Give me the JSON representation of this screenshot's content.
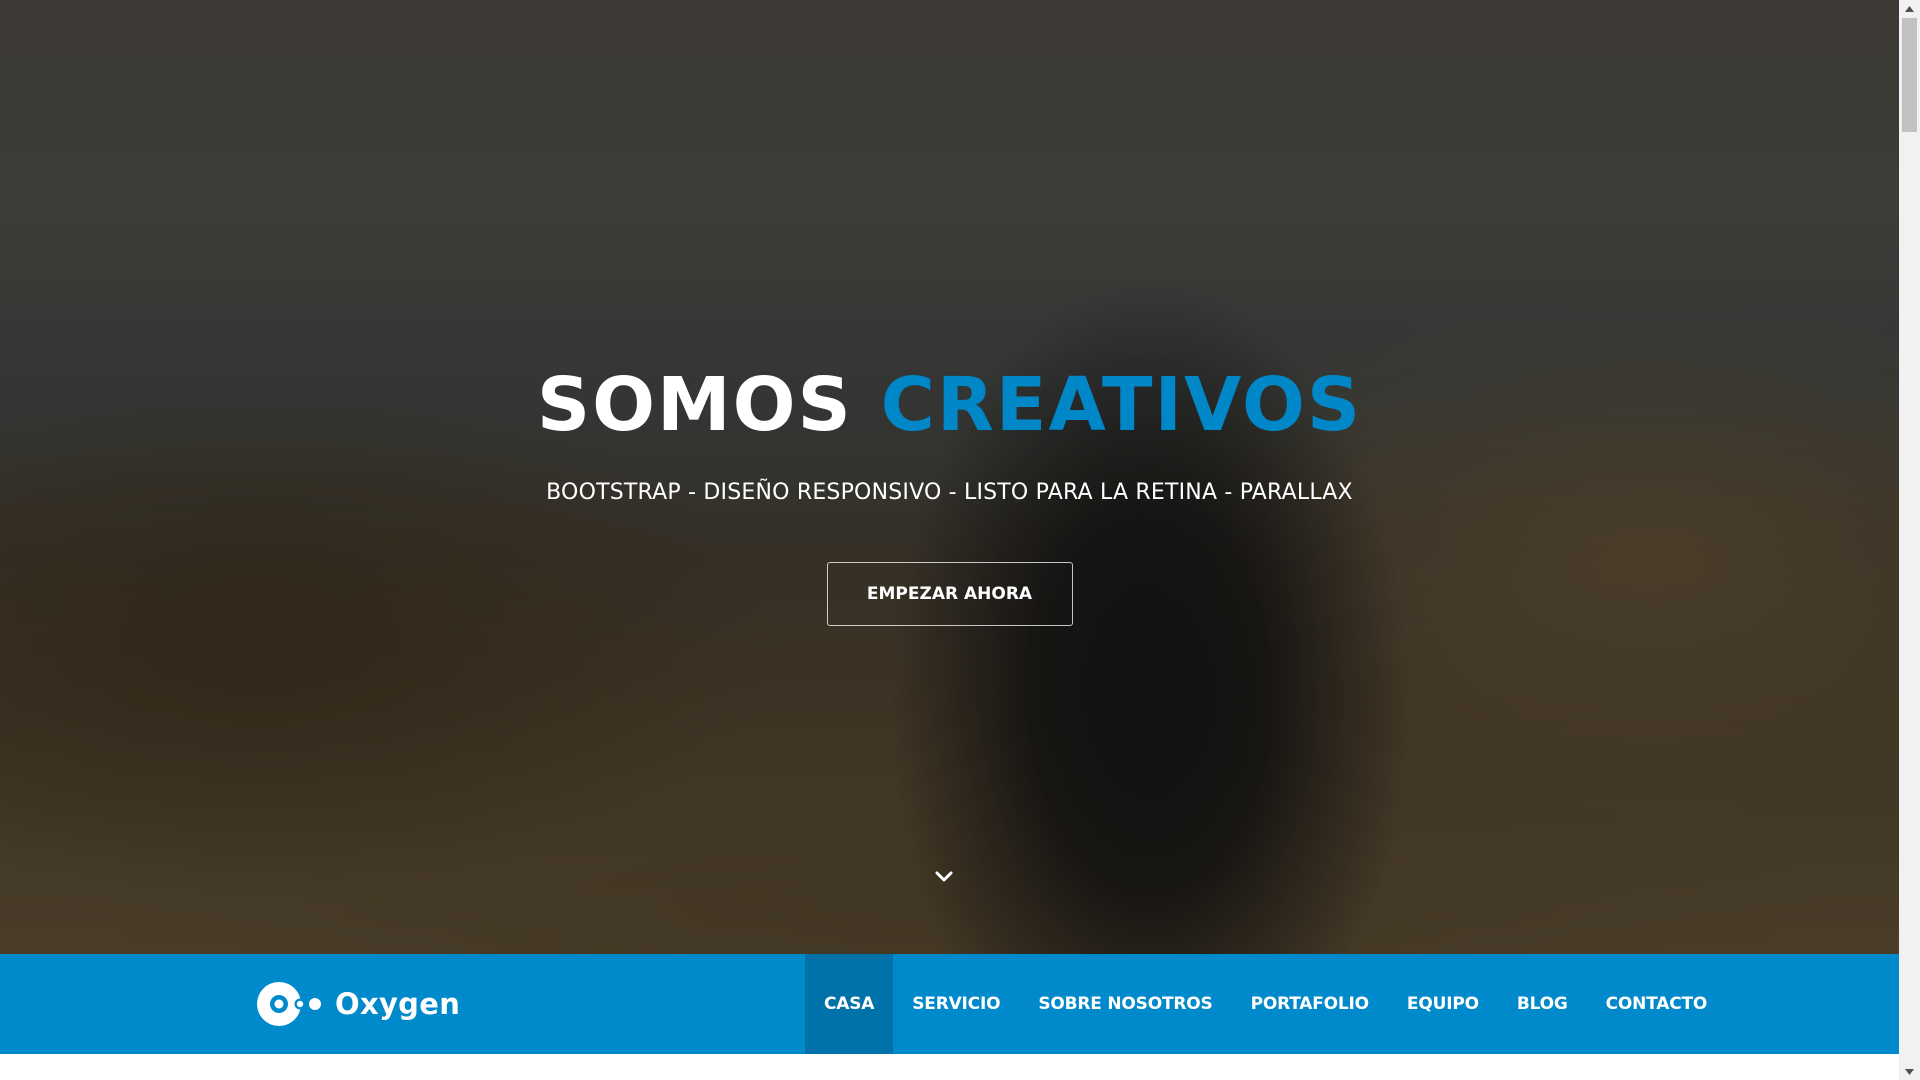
{
  "hero": {
    "title_main": "SOMOS",
    "title_accent": "CREATIVOS",
    "subtitle": "BOOTSTRAP - DISEÑO RESPONSIVO - LISTO PARA LA RETINA - PARALLAX",
    "cta_label": "EMPEZAR AHORA",
    "scroll_icon": "chevron-down-icon"
  },
  "navbar": {
    "brand": "Oxygen",
    "brand_icon": "oxygen-logo-icon",
    "items": [
      {
        "label": "CASA",
        "active": true
      },
      {
        "label": "SERVICIO",
        "active": false
      },
      {
        "label": "SOBRE NOSOTROS",
        "active": false
      },
      {
        "label": "PORTAFOLIO",
        "active": false
      },
      {
        "label": "EQUIPO",
        "active": false
      },
      {
        "label": "BLOG",
        "active": false
      },
      {
        "label": "CONTACTO",
        "active": false
      }
    ]
  },
  "colors": {
    "accent": "#0087c8",
    "navbar_bg": "#0089cb",
    "navbar_active_bg": "#0071a9",
    "text_light": "#ffffff"
  }
}
